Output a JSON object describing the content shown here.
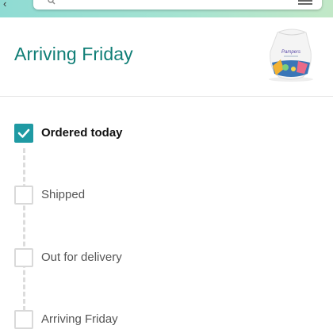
{
  "header": {
    "search_placeholder": "",
    "back_icon": "chevron-left-icon",
    "menu_icon": "hamburger-icon"
  },
  "delivery": {
    "title": "Arriving Friday",
    "product_image": "diaper-bag-product-image",
    "product_brand_text": "Pampers"
  },
  "steps": [
    {
      "label": "Ordered today",
      "status": "done"
    },
    {
      "label": "Shipped",
      "status": "pending"
    },
    {
      "label": "Out for delivery",
      "status": "pending"
    },
    {
      "label": "Arriving Friday",
      "status": "pending"
    }
  ],
  "colors": {
    "accent": "#1f9aa3",
    "title_teal": "#0f7e76",
    "header_gradient_start": "#8fdbd3",
    "header_gradient_end": "#c2e8c7"
  }
}
